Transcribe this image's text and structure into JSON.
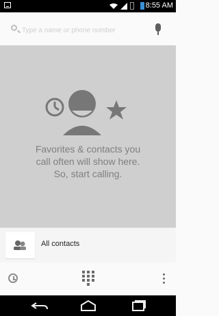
{
  "status_bar": {
    "time": "8:55 AM"
  },
  "search": {
    "placeholder": "Type a name or phone number"
  },
  "empty_state": {
    "line1": "Favorites & contacts you",
    "line2": "call often will show here.",
    "line3": "So, start calling."
  },
  "all_contacts": {
    "label": "All contacts"
  },
  "icons": {
    "status_left": "screenshot-icon",
    "wifi": "wifi-icon",
    "signal": "signal-icon",
    "battery": "battery-icon",
    "search": "search-icon",
    "mic": "mic-icon",
    "recent": "recent-icon",
    "dialpad": "dialpad-icon",
    "overflow": "overflow-icon",
    "contacts": "contacts-icon",
    "back": "back-icon",
    "home": "home-icon",
    "recents": "recents-icon"
  },
  "colors": {
    "statusbar_bg": "#000000",
    "main_bg": "#cfcfcf",
    "battery_accent": "#3a8fd7"
  }
}
